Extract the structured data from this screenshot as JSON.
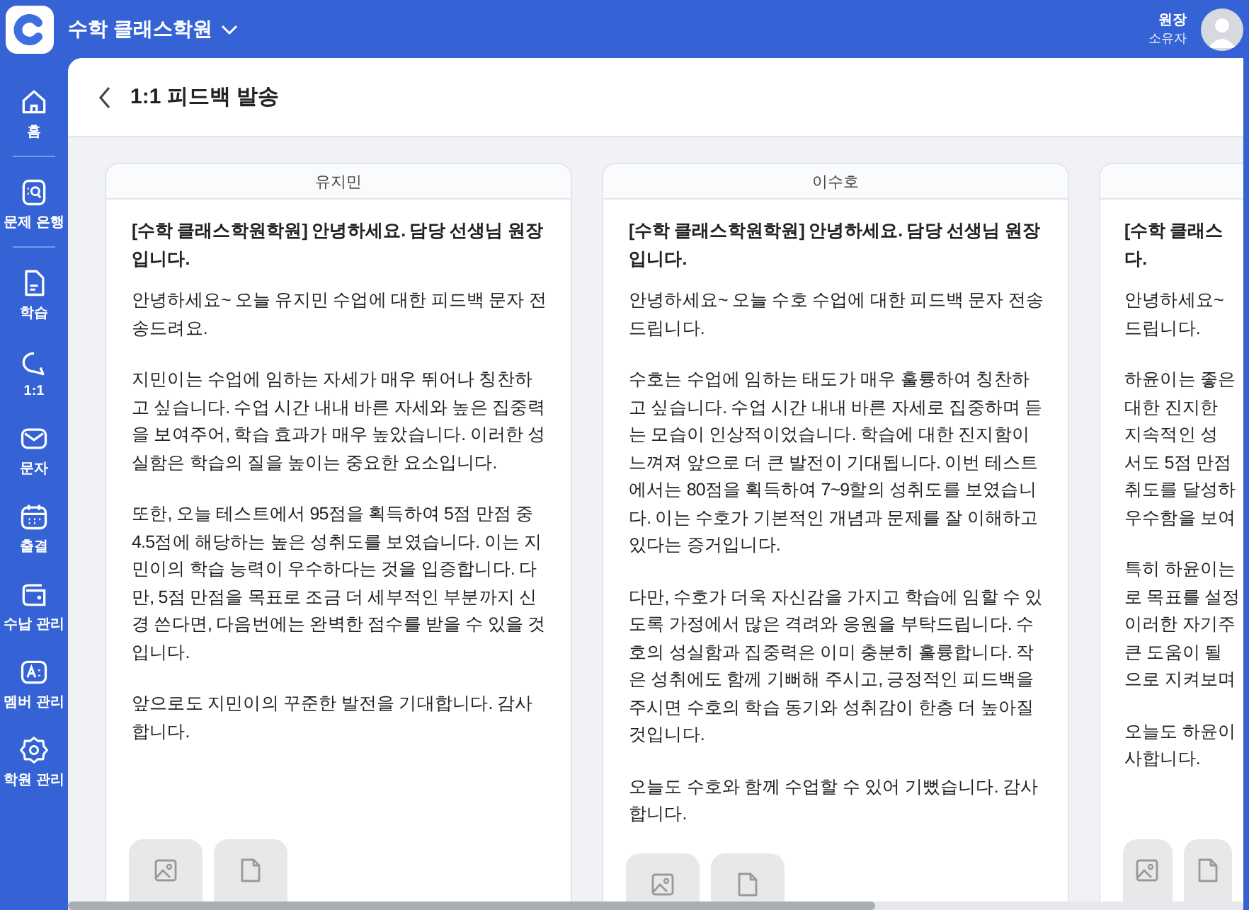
{
  "app": {
    "academy": "수학 클래스학원",
    "user_name": "원장",
    "user_role": "소유자"
  },
  "sidebar": {
    "items": [
      {
        "label": "홈",
        "divider": true
      },
      {
        "label": "문제 은행",
        "divider": true
      },
      {
        "label": "학습",
        "divider": false
      },
      {
        "label": "1:1",
        "divider": false
      },
      {
        "label": "문자",
        "divider": false
      },
      {
        "label": "출결",
        "divider": false
      },
      {
        "label": "수납 관리",
        "divider": false
      },
      {
        "label": "멤버 관리",
        "divider": false
      },
      {
        "label": "학원 관리",
        "divider": false
      }
    ]
  },
  "page": {
    "title": "1:1 피드백 발송"
  },
  "cards": [
    {
      "kind": "full",
      "name": "유지민",
      "greeting": "[수학 클래스학원학원] 안녕하세요. 담당 선생님 원장입니다.",
      "paragraphs": [
        "안녕하세요~ 오늘 유지민 수업에 대한 피드백 문자 전송드려요.",
        "지민이는 수업에 임하는 자세가 매우 뛰어나 칭찬하고 싶습니다. 수업 시간 내내 바른 자세와 높은 집중력을 보여주어, 학습 효과가 매우 높았습니다. 이러한 성실함은 학습의 질을 높이는 중요한 요소입니다.",
        "또한, 오늘 테스트에서 95점을 획득하여 5점 만점 중 4.5점에 해당하는 높은 성취도를 보였습니다. 이는 지민이의 학습 능력이 우수하다는 것을 입증합니다. 다만, 5점 만점을 목표로 조금 더 세부적인 부분까지 신경 쓴다면, 다음번에는 완벽한 점수를 받을 수 있을 것입니다.",
        "앞으로도 지민이의 꾸준한 발전을 기대합니다. 감사합니다."
      ]
    },
    {
      "kind": "full",
      "name": "이수호",
      "greeting": "[수학 클래스학원학원] 안녕하세요. 담당 선생님 원장입니다.",
      "paragraphs": [
        "안녕하세요~ 오늘 수호 수업에 대한 피드백 문자 전송드립니다.",
        "수호는 수업에 임하는 태도가 매우 훌륭하여 칭찬하고 싶습니다. 수업 시간 내내 바른 자세로 집중하며 듣는 모습이 인상적이었습니다. 학습에 대한 진지함이 느껴져 앞으로 더 큰 발전이 기대됩니다. 이번 테스트에서는 80점을 획득하여 7~9할의 성취도를 보였습니다. 이는 수호가 기본적인 개념과 문제를 잘 이해하고 있다는 증거입니다.",
        "다만, 수호가 더욱 자신감을 가지고 학습에 임할 수 있도록 가정에서 많은 격려와 응원을 부탁드립니다. 수호의 성실함과 집중력은 이미 충분히 훌륭합니다. 작은 성취에도 함께 기뻐해 주시고, 긍정적인 피드백을 주시면 수호의 학습 동기와 성취감이 한층 더 높아질 것입니다.",
        "오늘도 수호와 함께 수업할 수 있어 기뻤습니다. 감사합니다."
      ]
    },
    {
      "kind": "clipped",
      "greeting_lines": [
        "[수학 클래스",
        "다."
      ],
      "paragraph_lines": [
        [
          "안녕하세요~",
          "드립니다."
        ],
        [
          "하윤이는 좋은",
          "대한 진지한",
          "지속적인 성",
          "서도 5점 만점",
          "취도를 달성하",
          "우수함을 보여"
        ],
        [
          "특히 하윤이는",
          "로 목표를 설정",
          "이러한 자기주",
          "큰 도움이 될",
          "으로 지켜보며"
        ],
        [
          "오늘도 하윤이",
          "사합니다."
        ]
      ]
    }
  ]
}
